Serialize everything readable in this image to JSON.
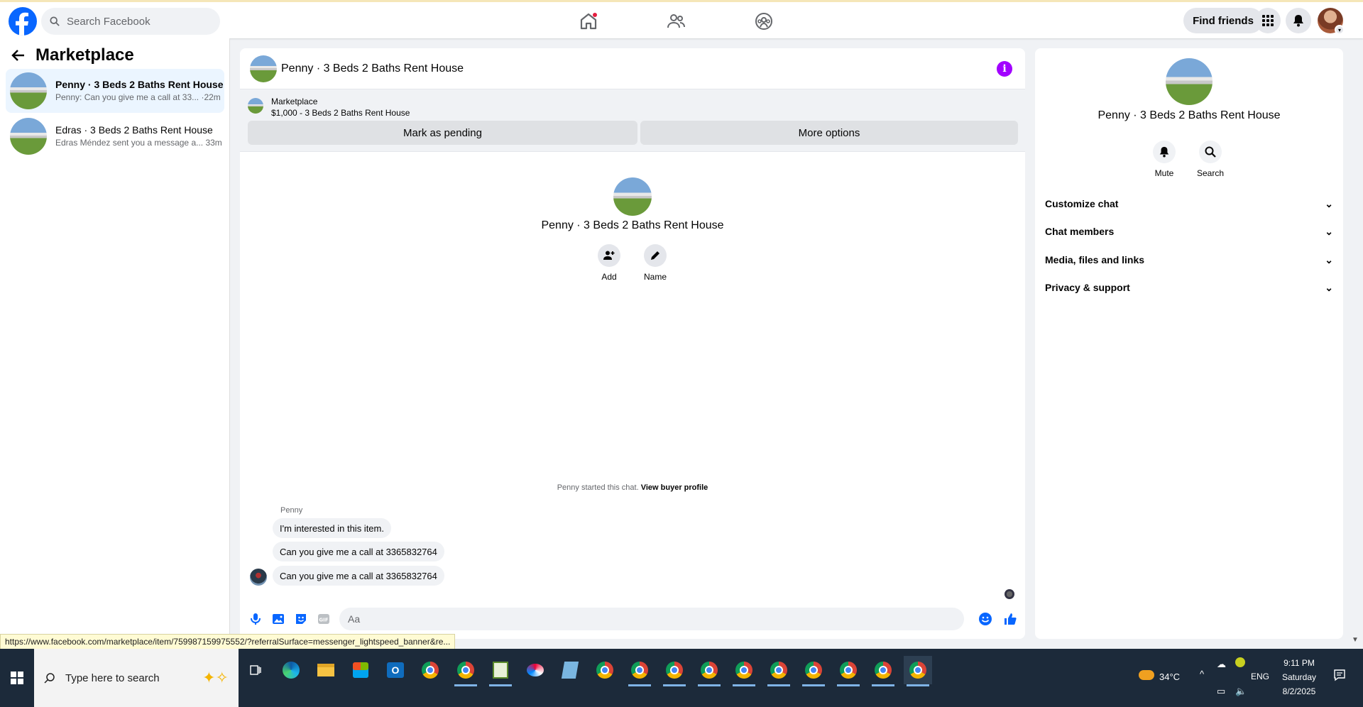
{
  "topbar": {
    "search_placeholder": "Search Facebook",
    "find_friends": "Find friends"
  },
  "left": {
    "title": "Marketplace",
    "conversations": [
      {
        "name": "Penny · 3 Beds 2 Baths Rent House",
        "preview": "Penny: Can you give me a call at 33... ·22m"
      },
      {
        "name": "Edras · 3 Beds 2 Baths Rent House",
        "preview": "Edras Méndez sent you a message a... 33m"
      }
    ]
  },
  "chat": {
    "title": "Penny · 3 Beds 2 Baths Rent House",
    "banner_label": "Marketplace",
    "banner_item": "$1,000 - 3 Beds 2 Baths Rent House",
    "mark_pending": "Mark as pending",
    "more_options": "More options",
    "intro_name": "Penny · 3 Beds 2 Baths Rent House",
    "add_label": "Add",
    "name_label": "Name",
    "started_text": "Penny started this chat.",
    "view_profile": "View buyer profile",
    "sender": "Penny",
    "messages": [
      "I'm interested in this item.",
      "Can you give me a call at 3365832764",
      "Can you give me a call at 3365832764"
    ],
    "composer_placeholder": "Aa"
  },
  "right": {
    "name": "Penny · 3 Beds 2 Baths Rent House",
    "mute": "Mute",
    "search": "Search",
    "sections": [
      "Customize chat",
      "Chat members",
      "Media, files and links",
      "Privacy & support"
    ]
  },
  "status_url": "https://www.facebook.com/marketplace/item/759987159975552/?referralSurface=messenger_lightspeed_banner&re...",
  "taskbar": {
    "search_placeholder": "Type here to search",
    "temperature": "34°C",
    "language": "ENG",
    "time": "9:11 PM",
    "day": "Saturday",
    "date": "8/2/2025"
  },
  "colors": {
    "brand": "#0866ff",
    "info": "#a200ff"
  }
}
